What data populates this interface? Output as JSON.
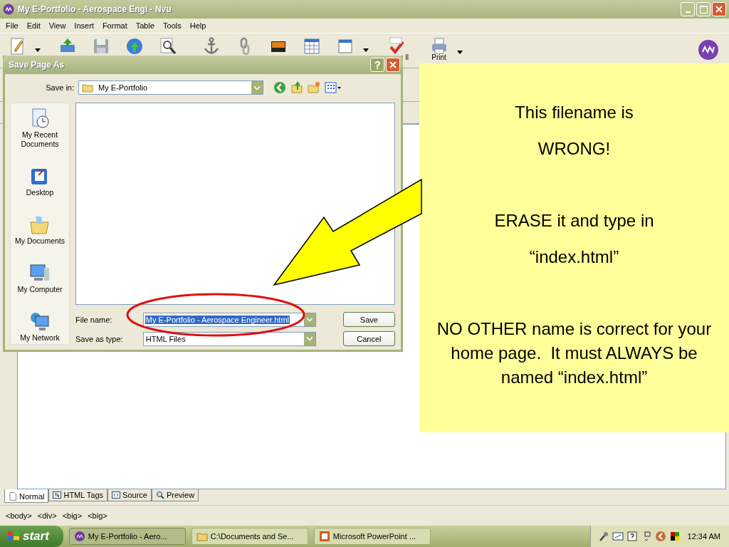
{
  "window": {
    "title": "My E-Portfolio - Aerospace Engi - Nvu"
  },
  "menu": [
    "File",
    "Edit",
    "View",
    "Insert",
    "Format",
    "Table",
    "Tools",
    "Help"
  ],
  "toolbar": [
    {
      "kind": "new",
      "dropdown": true
    },
    {
      "kind": "publish"
    },
    {
      "kind": "save"
    },
    {
      "kind": "browse"
    },
    {
      "kind": "find"
    },
    {
      "kind": "anchor"
    },
    {
      "kind": "link"
    },
    {
      "kind": "image"
    },
    {
      "kind": "table"
    },
    {
      "kind": "form",
      "dropdown": true
    },
    {
      "kind": "spell",
      "label": "ll"
    },
    {
      "kind": "print",
      "dropdown": true,
      "label": "Print"
    }
  ],
  "dialog": {
    "title": "Save Page As",
    "save_in_label": "Save in:",
    "save_in": "My E-Portfolio",
    "places": [
      {
        "kind": "recent",
        "label": "My Recent Documents"
      },
      {
        "kind": "desktop",
        "label": "Desktop"
      },
      {
        "kind": "documents",
        "label": "My Documents"
      },
      {
        "kind": "computer",
        "label": "My Computer"
      },
      {
        "kind": "network",
        "label": "My Network"
      }
    ],
    "file_name_label": "File name:",
    "file_name": "My E-Portfolio - Aerospace Engineer.html",
    "file_name_selected": true,
    "type_label": "Save as type:",
    "type": "HTML Files",
    "buttons": [
      "Save",
      "Cancel"
    ]
  },
  "view_tabs": [
    {
      "label": "Normal",
      "kind": "normal",
      "selected": true
    },
    {
      "label": "HTML Tags",
      "kind": "tags",
      "selected": false
    },
    {
      "label": "Source",
      "kind": "source",
      "selected": false
    },
    {
      "label": "Preview",
      "kind": "preview",
      "selected": false
    }
  ],
  "tag_path": [
    "<body>",
    "<div>",
    "<big>",
    "<big>"
  ],
  "taskbar": {
    "start": "start",
    "tasks": [
      {
        "label": "My E-Portfolio - Aero...",
        "kind": "nvu",
        "selected": true
      },
      {
        "label": "C:\\Documents and Se...",
        "kind": "folder",
        "selected": false
      },
      {
        "label": "Microsoft PowerPoint ...",
        "kind": "powerpoint",
        "selected": false
      }
    ],
    "clock": "12:34 AM"
  },
  "note": {
    "lines": [
      "This filename is",
      "WRONG!",
      "ERASE it and type in",
      "“index.html”",
      "NO OTHER name is correct for your home page.  It must ALWAYS be named “index.html”"
    ]
  }
}
